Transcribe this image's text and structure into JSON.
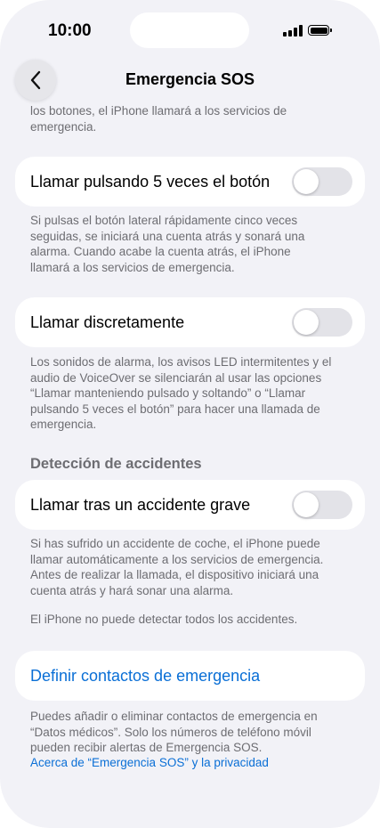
{
  "status_bar": {
    "time": "10:00"
  },
  "nav": {
    "title": "Emergencia SOS",
    "back_icon": "chevron-left-icon"
  },
  "intro_text_line1": "los botones, el iPhone llamará a los servicios de",
  "intro_text_line2": "emergencia.",
  "rows": {
    "press5": {
      "label": "Llamar pulsando 5 veces el botón",
      "on": false
    },
    "quiet": {
      "label": "Llamar discretamente",
      "on": false
    },
    "crash": {
      "label": "Llamar tras un accidente grave",
      "on": false
    }
  },
  "press5_footer": [
    "Si pulsas el botón lateral rápidamente cinco veces",
    "seguidas, se iniciará una cuenta atrás y sonará una",
    "alarma. Cuando acabe la cuenta atrás, el iPhone",
    "llamará a los servicios de emergencia."
  ],
  "quiet_footer": [
    "Los sonidos de alarma, los avisos LED intermitentes y el",
    "audio de VoiceOver se silenciarán al usar las opciones",
    "“Llamar manteniendo pulsado y soltando” o “Llamar",
    "pulsando 5 veces el botón” para hacer una llamada de",
    "emergencia."
  ],
  "crash_section_header": "Detección de accidentes",
  "crash_footer": [
    "Si has sufrido un accidente de coche, el iPhone puede",
    "llamar automáticamente a los servicios de emergencia.",
    "Antes de realizar la llamada, el dispositivo iniciará una",
    "cuenta atrás y hará sonar una alarma."
  ],
  "crash_note": "El iPhone no puede detectar todos los accidentes.",
  "contacts": {
    "label": "Definir contactos de emergencia"
  },
  "contacts_footer": [
    "Puedes añadir o eliminar contactos de emergencia en",
    "“Datos médicos”. Solo los números de teléfono móvil",
    "pueden recibir alertas de Emergencia SOS."
  ],
  "privacy_link": "Acerca de “Emergencia SOS” y la privacidad",
  "colors": {
    "background": "#f2f2f7",
    "card": "#ffffff",
    "link": "#0a6fd6",
    "secondary_text": "#6d6d72",
    "toggle_off": "#e3e3e8"
  }
}
